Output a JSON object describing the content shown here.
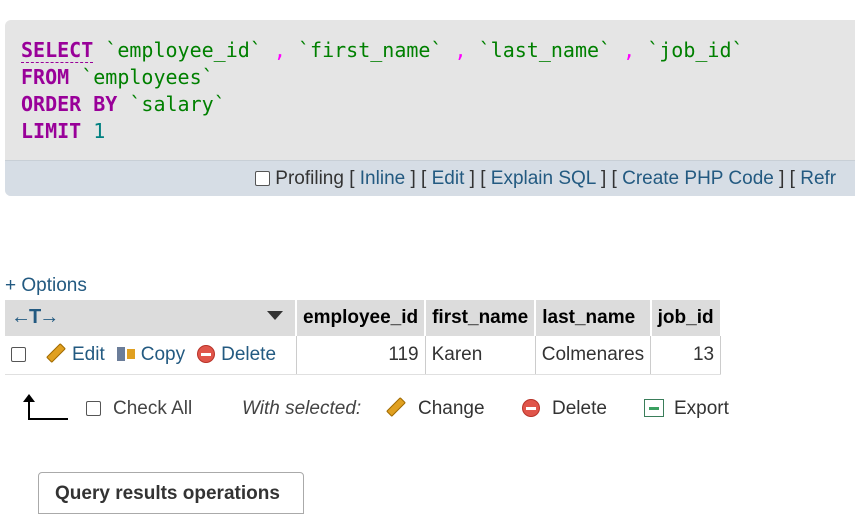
{
  "sql": {
    "kw_select": "SELECT",
    "kw_from": "FROM",
    "kw_order": "ORDER BY",
    "kw_limit": "LIMIT",
    "col1": "`employee_id`",
    "col2": "`first_name`",
    "col3": "`last_name`",
    "col4": "`job_id`",
    "sep": ",",
    "table": "`employees`",
    "order_col": "`salary`",
    "limit": "1"
  },
  "tools": {
    "profiling": "Profiling",
    "inline": "Inline",
    "edit": "Edit",
    "explain": "Explain SQL",
    "php": "Create PHP Code",
    "refresh": "Refr"
  },
  "options": {
    "label": "+ Options"
  },
  "table": {
    "columns": [
      "employee_id",
      "first_name",
      "last_name",
      "job_id"
    ],
    "actions": {
      "edit": "Edit",
      "copy": "Copy",
      "delete": "Delete"
    },
    "rows": [
      {
        "employee_id": "119",
        "first_name": "Karen",
        "last_name": "Colmenares",
        "job_id": "13"
      }
    ]
  },
  "bulk": {
    "check_all": "Check All",
    "with_selected": "With selected:",
    "change": "Change",
    "delete": "Delete",
    "export": "Export"
  },
  "query_ops": {
    "label": "Query results operations"
  }
}
